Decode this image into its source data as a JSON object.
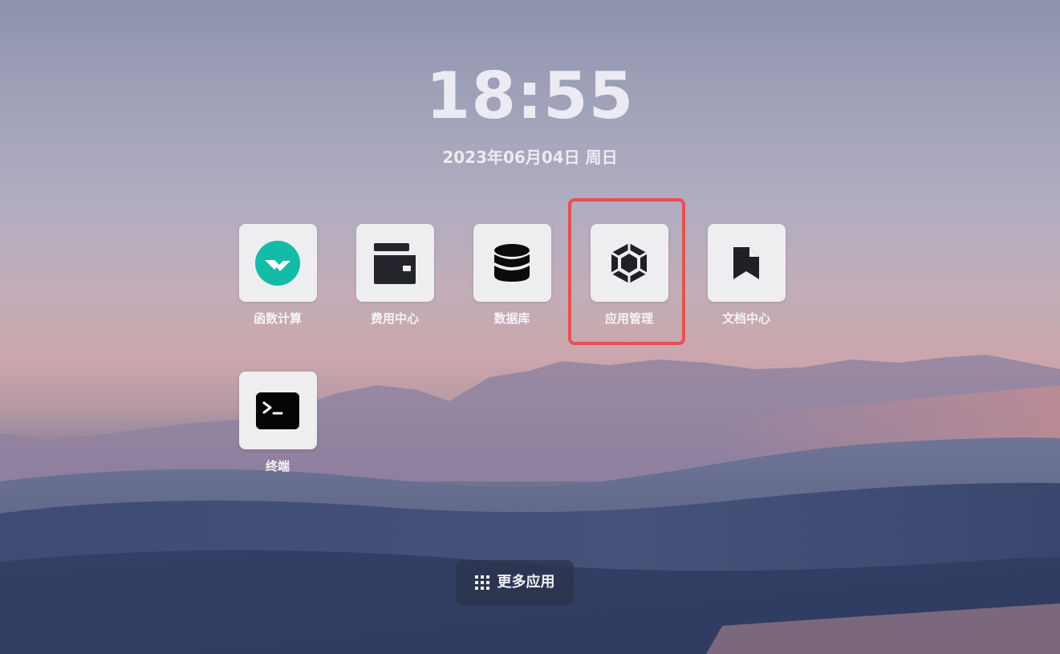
{
  "clock": {
    "time": "18:55"
  },
  "date": {
    "text": "2023年06月04日 周日"
  },
  "apps": [
    {
      "label": "函数计算",
      "icon": "function-compute-icon"
    },
    {
      "label": "费用中心",
      "icon": "wallet-icon"
    },
    {
      "label": "数据库",
      "icon": "database-icon"
    },
    {
      "label": "应用管理",
      "icon": "hexagon-cube-icon"
    },
    {
      "label": "文档中心",
      "icon": "document-icon"
    },
    {
      "label": "终端",
      "icon": "terminal-icon"
    }
  ],
  "highlighted_app": "应用管理",
  "more_apps": {
    "label": "更多应用",
    "icon": "grid-icon"
  },
  "colors": {
    "highlight_border": "#e8504e",
    "tile_background": "#eeeef1",
    "function_compute_accent": "#14bba6"
  }
}
